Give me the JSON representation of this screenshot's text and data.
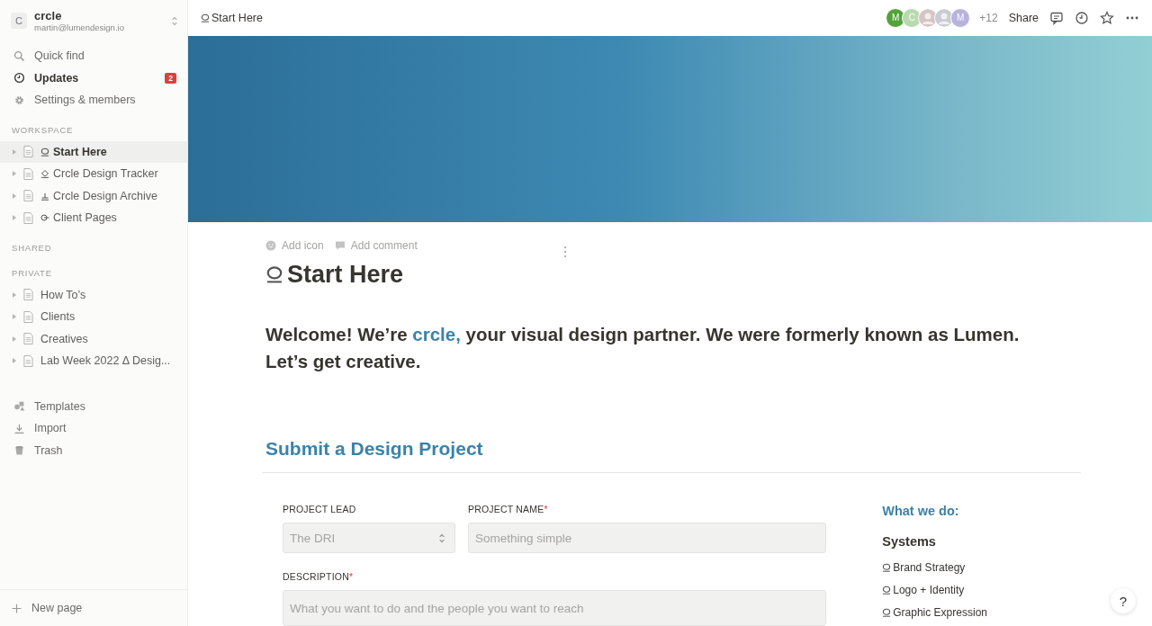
{
  "workspace": {
    "initial": "C",
    "name": "crcle",
    "email": "martin@lumendesign.io"
  },
  "nav": [
    {
      "kind": "search",
      "label": "Quick find",
      "selected": false
    },
    {
      "kind": "clock",
      "label": "Updates",
      "selected": true,
      "badge": "2"
    },
    {
      "kind": "gear",
      "label": "Settings & members",
      "selected": false
    }
  ],
  "sections": [
    {
      "title": "WORKSPACE",
      "pages": [
        {
          "kind": "ring",
          "label": "Start Here",
          "selected": true
        },
        {
          "kind": "diamond",
          "label": "Crcle Design Tracker",
          "selected": false
        },
        {
          "kind": "anchor",
          "label": "Crcle Design Archive",
          "selected": false
        },
        {
          "kind": "arrow",
          "label": "Client Pages",
          "selected": false
        }
      ]
    },
    {
      "title": "SHARED"
    },
    {
      "title": "PRIVATE",
      "pages": [
        {
          "label": "How To’s",
          "selected": false
        },
        {
          "label": "Clients",
          "selected": false
        },
        {
          "label": "Creatives",
          "selected": false
        },
        {
          "label": "Lab Week 2022 Δ Desig...",
          "selected": false
        }
      ]
    }
  ],
  "tools": [
    {
      "kind": "templates",
      "label": "Templates"
    },
    {
      "kind": "import",
      "label": "Import"
    },
    {
      "kind": "trash",
      "label": "Trash"
    }
  ],
  "new_page": "New page",
  "breadcrumb": {
    "kind": "ring",
    "label": "Start Here"
  },
  "avatars": [
    {
      "kind": "letter",
      "initial": "M",
      "color": "#52a33a"
    },
    {
      "kind": "letter",
      "initial": "C",
      "color": "#b9d9b0"
    },
    {
      "kind": "photo",
      "color": "#d7c4c4"
    },
    {
      "kind": "photo",
      "color": "#c9cdd3"
    },
    {
      "kind": "letter",
      "initial": "M",
      "color": "#b7b3de"
    }
  ],
  "more_members": "+12",
  "share": "Share",
  "page_actions": [
    "Add icon",
    "Add comment"
  ],
  "title": {
    "kind": "ring",
    "text": "Start Here"
  },
  "welcome": "Welcome! We’re ",
  "welcome_link": "crcle,",
  "welcome_rest": " your visual design partner. We were formerly known as Lumen. Let’s get creative.",
  "section_heading": "Submit a Design Project",
  "form": {
    "project_lead": {
      "label": "PROJECT LEAD",
      "placeholder": "The DRI"
    },
    "project_name": {
      "label": "PROJECT NAME",
      "required_mark": "*",
      "placeholder": "Something simple"
    },
    "description": {
      "label": "DESCRIPTION",
      "required_mark": "*",
      "placeholder": "What you want to do and the people you want to reach"
    }
  },
  "aside": {
    "heading": "What we do:",
    "group": "Systems",
    "items": [
      {
        "kind": "ring",
        "label": "Brand Strategy"
      },
      {
        "kind": "ring",
        "label": "Logo + Identity"
      },
      {
        "kind": "ring",
        "label": "Graphic Expression"
      }
    ]
  },
  "help": "?"
}
